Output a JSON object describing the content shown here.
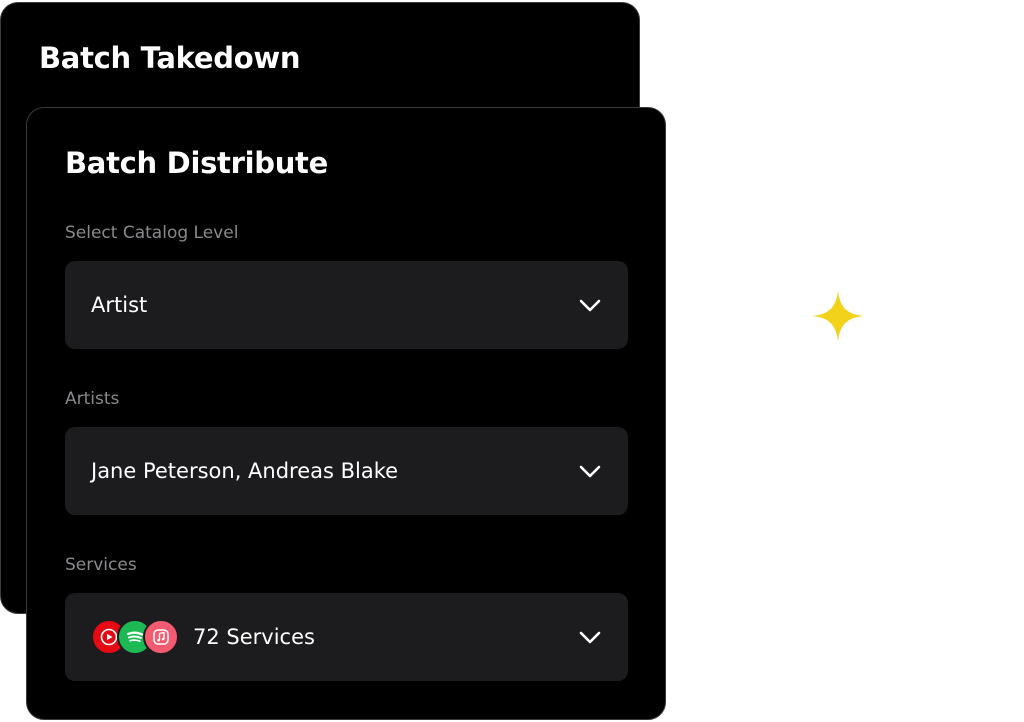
{
  "back_card": {
    "title": "Batch Takedown"
  },
  "front_card": {
    "title": "Batch Distribute",
    "catalog_level": {
      "label": "Select Catalog Level",
      "value": "Artist"
    },
    "artists": {
      "label": "Artists",
      "value": "Jane Peterson, Andreas Blake"
    },
    "services": {
      "label": "Services",
      "value": "72 Services",
      "icons": [
        "youtube-music-icon",
        "spotify-icon",
        "apple-music-icon"
      ]
    }
  },
  "decoration": {
    "sparkle_icon": "sparkle-icon",
    "sparkle_color": "#f2d21a"
  },
  "colors": {
    "card_bg": "#000000",
    "field_bg": "#1c1c1e",
    "label": "#8a8a8e",
    "youtube_red": "#e50914",
    "spotify_green": "#1db954",
    "apple_pink": "#f45b70"
  }
}
